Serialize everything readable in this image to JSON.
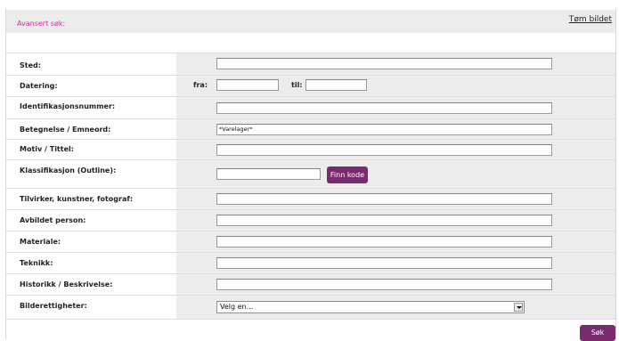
{
  "header": {
    "title": "Avansert søk:",
    "clear_link": "Tøm bildet"
  },
  "fields": {
    "sted": {
      "label": "Sted:",
      "value": ""
    },
    "datering": {
      "label": "Datering:",
      "from_label": "fra:",
      "to_label": "til:",
      "from_value": "",
      "to_value": ""
    },
    "ident": {
      "label": "Identifikasjonsnummer:",
      "value": ""
    },
    "betegnelse": {
      "label": "Betegnelse / Emneord:",
      "value": "*Varelager*"
    },
    "motiv": {
      "label": "Motiv / Tittel:",
      "value": ""
    },
    "klass": {
      "label": "Klassifikasjon (Outline):",
      "value": "",
      "button": "Finn kode"
    },
    "tilvirker": {
      "label": "Tilvirker, kunstner, fotograf:",
      "value": ""
    },
    "avbildet": {
      "label": "Avbildet person:",
      "value": ""
    },
    "materiale": {
      "label": "Materiale:",
      "value": ""
    },
    "teknikk": {
      "label": "Teknikk:",
      "value": ""
    },
    "historikk": {
      "label": "Historikk / Beskrivelse:",
      "value": ""
    },
    "rettigheter": {
      "label": "Bilderettigheter:",
      "selected": "Velg en..."
    }
  },
  "search_button": "Søk",
  "colors": {
    "accent": "#7a2a6e",
    "title_pink": "#d22aa0",
    "panel_grey": "#ececec"
  }
}
